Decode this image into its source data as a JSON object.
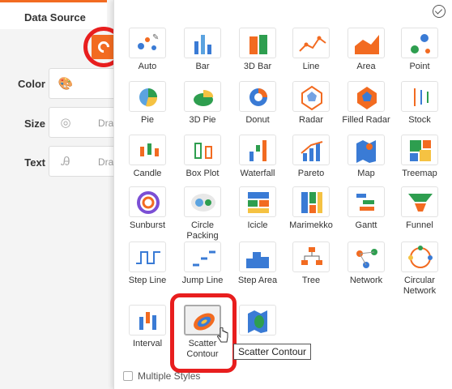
{
  "left_panel": {
    "data_source_label": "Data Source",
    "props": [
      {
        "label": "Color",
        "icon": "palette-icon",
        "placeholder": ""
      },
      {
        "label": "Size",
        "icon": "size-icon",
        "placeholder": "Dra"
      },
      {
        "label": "Text",
        "icon": "text-icon",
        "placeholder": "Dra"
      }
    ]
  },
  "chart_types": [
    "Auto",
    "Bar",
    "3D Bar",
    "Line",
    "Area",
    "Point",
    "Pie",
    "3D Pie",
    "Donut",
    "Radar",
    "Filled Radar",
    "Stock",
    "Candle",
    "Box Plot",
    "Waterfall",
    "Pareto",
    "Map",
    "Treemap",
    "Sunburst",
    "Circle Packing",
    "Icicle",
    "Marimekko",
    "Gantt",
    "Funnel",
    "Step Line",
    "Jump Line",
    "Step Area",
    "Tree",
    "Network",
    "Circular Network",
    "Interval",
    "Scatter Contour",
    ""
  ],
  "tooltip": "Scatter Contour",
  "multiple_styles_label": "Multiple Styles",
  "colors": {
    "accent": "#f26b21",
    "highlight": "#e81e1e"
  }
}
